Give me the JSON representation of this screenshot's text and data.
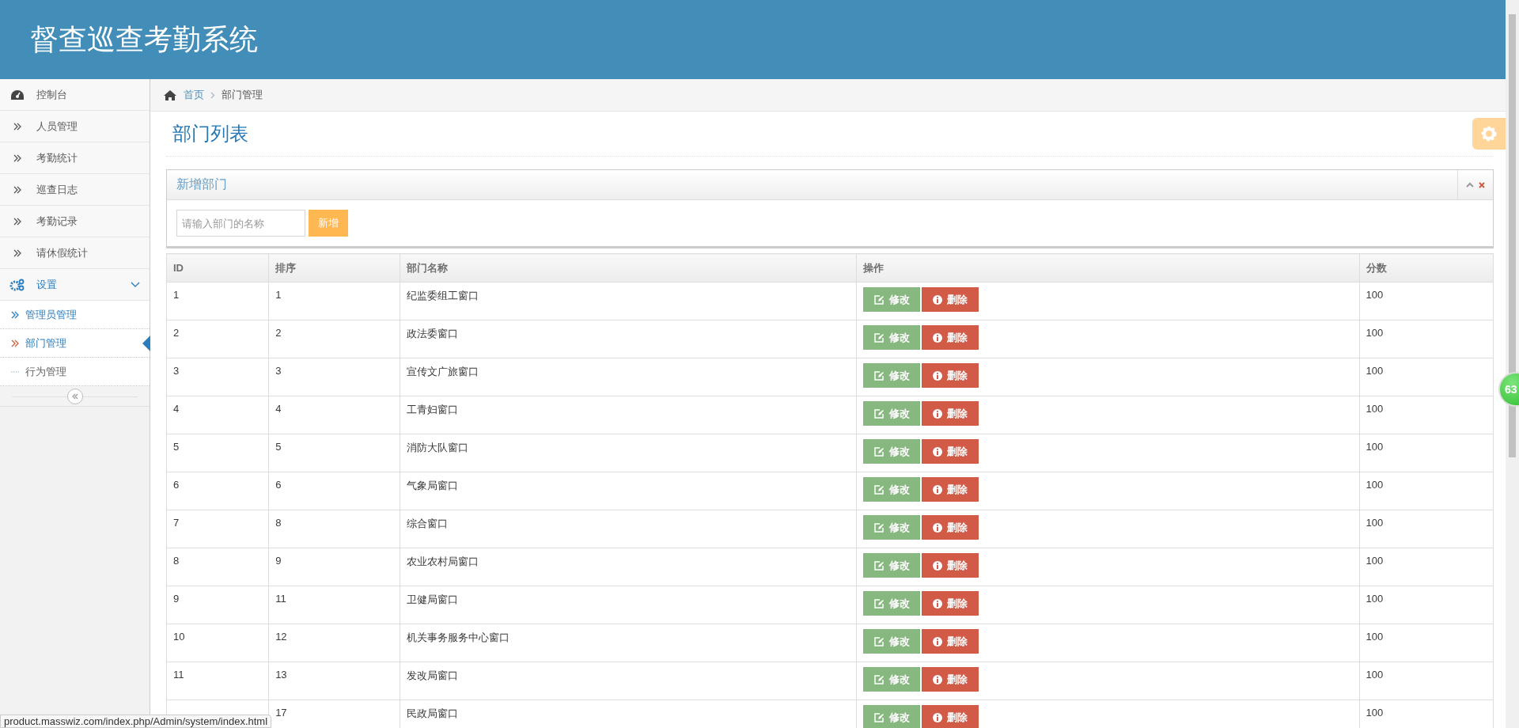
{
  "header": {
    "title": "督查巡查考勤系统"
  },
  "sidebar": {
    "items": [
      {
        "kind": "dashboard",
        "label": "控制台"
      },
      {
        "kind": "link",
        "label": "人员管理"
      },
      {
        "kind": "link",
        "label": "考勤统计"
      },
      {
        "kind": "link",
        "label": "巡查日志"
      },
      {
        "kind": "link",
        "label": "考勤记录"
      },
      {
        "kind": "link",
        "label": "请休假统计"
      },
      {
        "kind": "group",
        "label": "设置",
        "expanded": true,
        "children": [
          {
            "label": "管理员管理",
            "selected": false,
            "hovered": true
          },
          {
            "label": "部门管理",
            "selected": true,
            "hovered": false
          },
          {
            "label": "行为管理",
            "selected": false,
            "hovered": false
          }
        ]
      }
    ]
  },
  "breadcrumb": {
    "home": "首页",
    "current": "部门管理"
  },
  "page_title": "部门列表",
  "add_panel": {
    "title": "新增部门",
    "placeholder": "请输入部门的名称",
    "button": "新增"
  },
  "table": {
    "columns": [
      "ID",
      "排序",
      "部门名称",
      "操作",
      "分数"
    ],
    "rows": [
      {
        "id": "1",
        "order": "1",
        "name": "纪监委组工窗口",
        "score": "100",
        "actions": [
          {
            "kind": "edit",
            "label": "修改"
          },
          {
            "kind": "delete",
            "label": "删除"
          }
        ]
      },
      {
        "id": "2",
        "order": "2",
        "name": "政法委窗口",
        "score": "100",
        "actions": [
          {
            "kind": "edit",
            "label": "修改"
          },
          {
            "kind": "delete",
            "label": "删除"
          }
        ]
      },
      {
        "id": "3",
        "order": "3",
        "name": "宣传文广旅窗口",
        "score": "100",
        "actions": [
          {
            "kind": "edit",
            "label": "修改"
          },
          {
            "kind": "delete",
            "label": "删除"
          }
        ]
      },
      {
        "id": "4",
        "order": "4",
        "name": "工青妇窗口",
        "score": "100",
        "actions": [
          {
            "kind": "edit",
            "label": "修改"
          },
          {
            "kind": "delete",
            "label": "删除"
          }
        ]
      },
      {
        "id": "5",
        "order": "5",
        "name": "消防大队窗口",
        "score": "100",
        "actions": [
          {
            "kind": "edit",
            "label": "修改"
          },
          {
            "kind": "delete",
            "label": "删除"
          }
        ]
      },
      {
        "id": "6",
        "order": "6",
        "name": "气象局窗口",
        "score": "100",
        "actions": [
          {
            "kind": "edit",
            "label": "修改"
          },
          {
            "kind": "delete",
            "label": "删除"
          }
        ]
      },
      {
        "id": "7",
        "order": "8",
        "name": "综合窗口",
        "score": "100",
        "actions": [
          {
            "kind": "edit",
            "label": "修改"
          },
          {
            "kind": "delete",
            "label": "删除"
          }
        ]
      },
      {
        "id": "8",
        "order": "9",
        "name": "农业农村局窗口",
        "score": "100",
        "actions": [
          {
            "kind": "edit",
            "label": "修改"
          },
          {
            "kind": "delete",
            "label": "删除"
          }
        ]
      },
      {
        "id": "9",
        "order": "11",
        "name": "卫健局窗口",
        "score": "100",
        "actions": [
          {
            "kind": "edit",
            "label": "修改"
          },
          {
            "kind": "delete",
            "label": "删除"
          }
        ]
      },
      {
        "id": "10",
        "order": "12",
        "name": "机关事务服务中心窗口",
        "score": "100",
        "actions": [
          {
            "kind": "edit",
            "label": "修改"
          },
          {
            "kind": "delete",
            "label": "删除"
          }
        ]
      },
      {
        "id": "11",
        "order": "13",
        "name": "发改局窗口",
        "score": "100",
        "actions": [
          {
            "kind": "edit",
            "label": "修改"
          },
          {
            "kind": "delete",
            "label": "删除"
          }
        ]
      },
      {
        "order": "17",
        "name": "民政局窗口",
        "score": "100",
        "actions": [
          {
            "kind": "edit",
            "label": "修改"
          },
          {
            "kind": "delete",
            "label": "删除"
          }
        ]
      }
    ]
  },
  "status_bar": {
    "url": "product.masswiz.com/index.php/Admin/system/index.html"
  },
  "floating_badge": {
    "count": "63"
  }
}
